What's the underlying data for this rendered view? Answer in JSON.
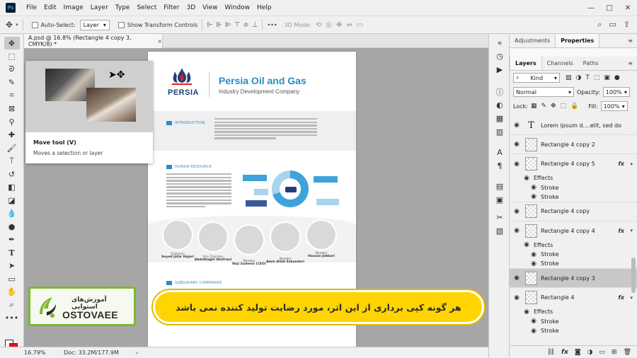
{
  "menu": {
    "app_icon": "Ps",
    "items": [
      "File",
      "Edit",
      "Image",
      "Layer",
      "Type",
      "Select",
      "Filter",
      "3D",
      "View",
      "Window",
      "Help"
    ],
    "window_controls": [
      "—",
      "□",
      "✕"
    ]
  },
  "options_bar": {
    "auto_select_label": "Auto-Select:",
    "auto_select_value": "Layer",
    "show_transform_label": "Show Transform Controls",
    "more": "•••",
    "threed_mode_label": "3D Mode:"
  },
  "document_tab": {
    "title": "A.psd @ 16.8% (Rectangle 4 copy 3, CMYK/8) *",
    "close": "×"
  },
  "document": {
    "persia_wordmark": "PERSIA",
    "company_name": "Persia Oil and Gas",
    "company_sub": "Industry Development Company",
    "sections": {
      "intro": "INTRODUCTION",
      "hr": "HUMAN RESOURCE",
      "subsidiary": "SUBSIDIARY COMPANIES"
    },
    "lorem_heading": "Lorem ipsum dolor sit amet, consectetur adipiscing elit, sed do",
    "people": [
      {
        "role": "Chairman",
        "name": "Seyed Jafar Hajari"
      },
      {
        "role": "Vice Chairman",
        "name": "Abdolbaghi Ghofrani"
      },
      {
        "role": "Member",
        "name": "Naji Sadeeni (CEO)"
      },
      {
        "role": "Member",
        "name": "Amin Allah Eskandari"
      },
      {
        "role": "Member",
        "name": "Hassan Jabbari"
      }
    ]
  },
  "tooltip": {
    "title": "Move tool (V)",
    "description": "Moves a selection or layer"
  },
  "watermark": {
    "persian": "آموزش‌های استوایی",
    "latin": "OSTOVAEE"
  },
  "banner": {
    "text": "هر گونه کپی برداری از این اثر، مورد رضایت تولید کننده نمی باشد"
  },
  "status": {
    "zoom": "16.79%",
    "doc": "Doc: 33.2M/177.9M",
    "arrow": "›"
  },
  "panels": {
    "top_tabs": [
      "Adjustments",
      "Properties"
    ],
    "layer_tabs": [
      "Layers",
      "Channels",
      "Paths"
    ],
    "kind": "Kind",
    "blend": "Normal",
    "opacity_label": "Opacity:",
    "opacity_value": "100%",
    "lock_label": "Lock:",
    "fill_label": "Fill:",
    "fill_value": "100%",
    "layers": [
      {
        "name": "Lorem ipsum d....elit, sed do",
        "type": "text"
      },
      {
        "name": "Rectangle 4 copy 2",
        "type": "shape"
      },
      {
        "name": "Rectangle 4 copy 5",
        "type": "shape",
        "fx": true,
        "effects": [
          "Effects",
          "Stroke",
          "Stroke"
        ]
      },
      {
        "name": "Rectangle 4 copy",
        "type": "shape"
      },
      {
        "name": "Rectangle 4 copy 4",
        "type": "shape",
        "fx": true,
        "effects": [
          "Effects",
          "Stroke",
          "Stroke"
        ]
      },
      {
        "name": "Rectangle 4 copy 3",
        "type": "shape",
        "selected": true
      },
      {
        "name": "Rectangle 4",
        "type": "shape",
        "fx": true,
        "effects": [
          "Effects",
          "Stroke",
          "Stroke"
        ]
      }
    ],
    "fx_label": "fx"
  },
  "colors": {
    "accent": "#2a8cc4",
    "brand_navy": "#223d7a",
    "banner": "#ffd400",
    "watermark_green": "#7cb82f"
  }
}
